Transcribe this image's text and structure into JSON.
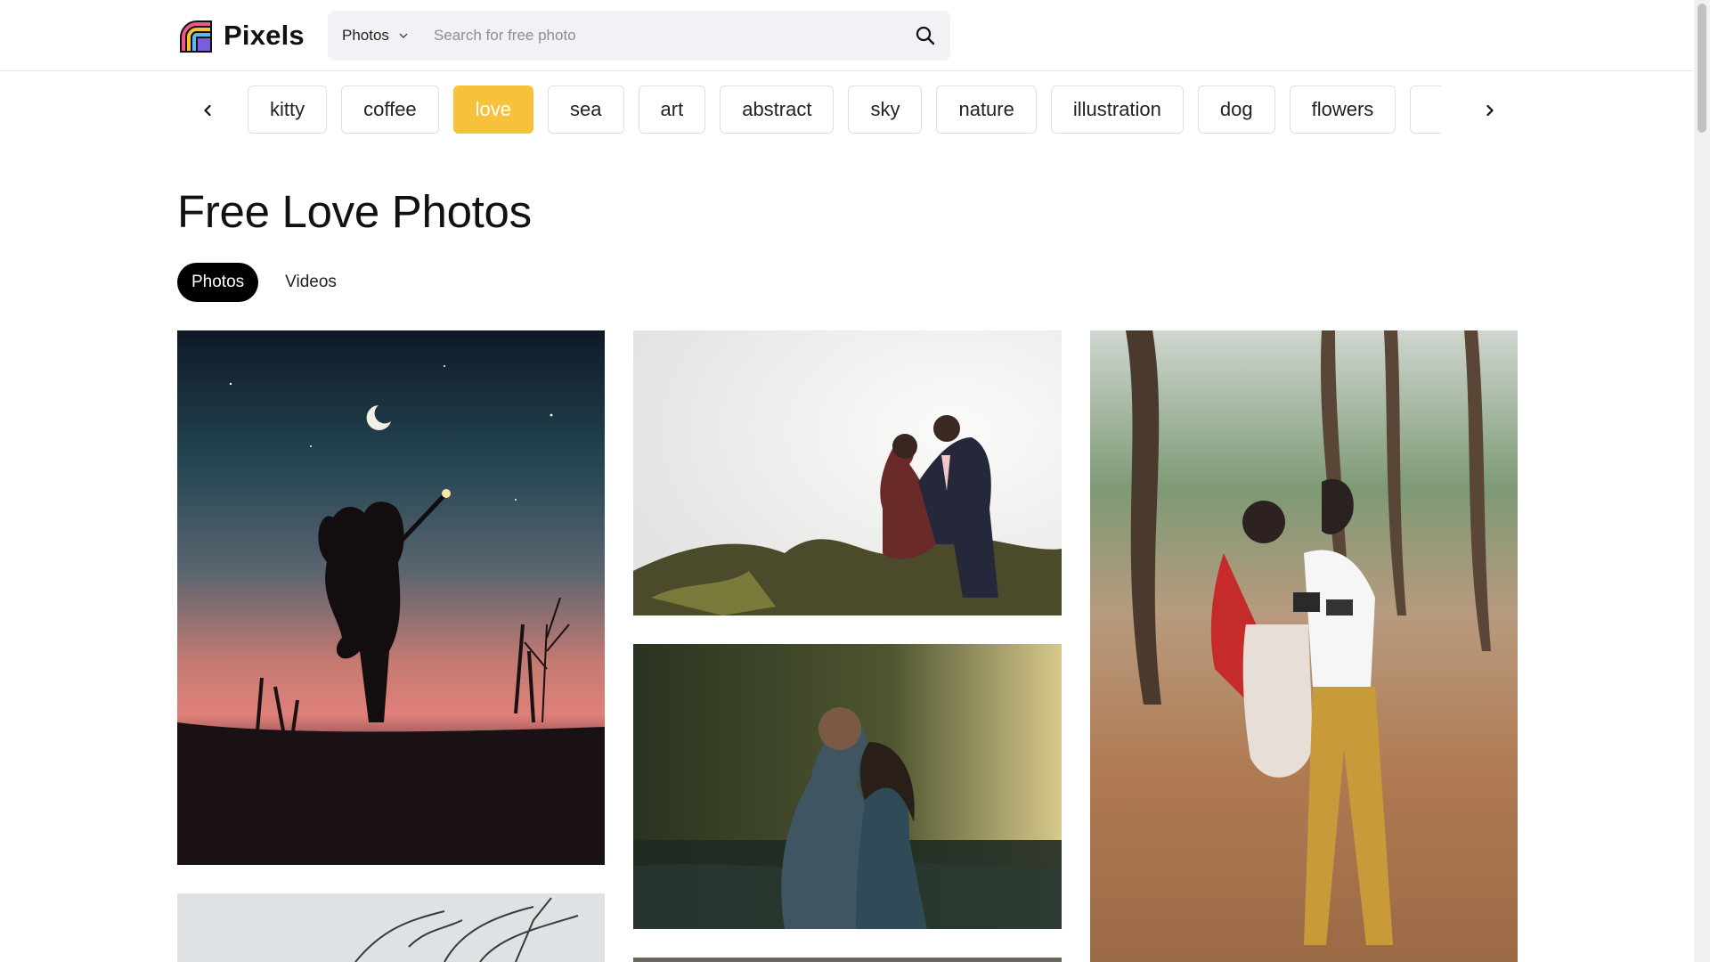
{
  "brand": {
    "name": "Pixels",
    "logo_icon": "rainbow-logo-icon"
  },
  "search": {
    "type_label": "Photos",
    "placeholder": "Search for free photo",
    "value": "",
    "icons": {
      "dropdown": "chevron-down-icon",
      "submit": "search-icon"
    }
  },
  "categories": {
    "prev_icon": "chevron-left-icon",
    "next_icon": "chevron-right-icon",
    "items": [
      {
        "label": "kitty",
        "active": false
      },
      {
        "label": "coffee",
        "active": false
      },
      {
        "label": "love",
        "active": true
      },
      {
        "label": "sea",
        "active": false
      },
      {
        "label": "art",
        "active": false
      },
      {
        "label": "abstract",
        "active": false
      },
      {
        "label": "sky",
        "active": false
      },
      {
        "label": "nature",
        "active": false
      },
      {
        "label": "illustration",
        "active": false
      },
      {
        "label": "dog",
        "active": false
      },
      {
        "label": "flowers",
        "active": false
      },
      {
        "label": "",
        "active": false
      }
    ]
  },
  "page": {
    "title": "Free Love Photos",
    "tabs": [
      {
        "label": "Photos",
        "active": true
      },
      {
        "label": "Videos",
        "active": false
      }
    ]
  },
  "colors": {
    "accent": "#f7c23b",
    "search_bg": "#f1f2f5",
    "chip_border": "#dfdfe0",
    "tab_active_bg": "#000000"
  },
  "photos": [
    {
      "subject": "couple-silhouette-night-sky"
    },
    {
      "subject": "couple-kissing-forehead-hill"
    },
    {
      "subject": "couple-hugging-by-lake"
    },
    {
      "subject": "couple-in-pine-forest-with-camera"
    },
    {
      "subject": "bare-trees"
    },
    {
      "subject": "partial-photo"
    }
  ]
}
